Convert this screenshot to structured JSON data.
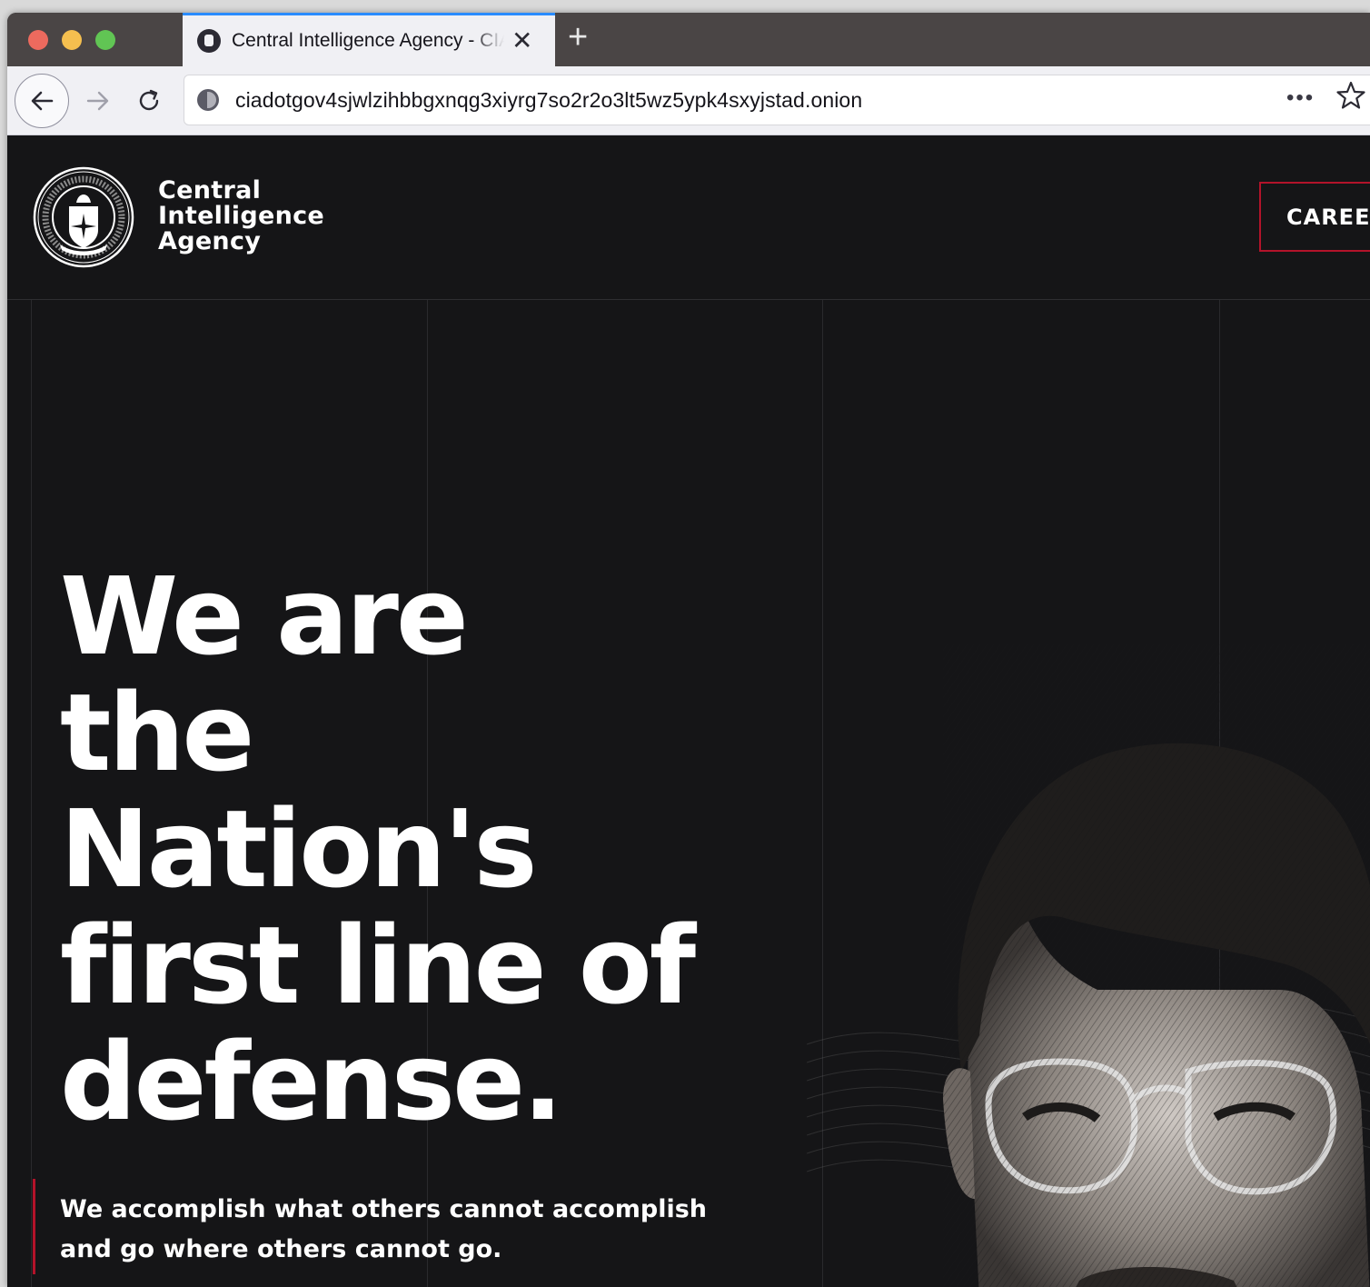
{
  "browser": {
    "tab_title": "Central Intelligence Agency - CIA",
    "new_tab_label": "+",
    "close_glyph": "✕",
    "url": "ciadotgov4sjwlzihbbgxnqg3xiyrg7so2r2o3lt5wz5ypk4sxyjstad.onion",
    "page_actions_label": "•••",
    "icons": {
      "back": "arrow-left-icon",
      "forward": "arrow-right-icon",
      "reload": "reload-icon",
      "onion": "onion-site-icon",
      "bookmark": "star-icon",
      "favicon": "cia-favicon-icon"
    },
    "traffic_light_colors": [
      "#ed6a5e",
      "#f5bf4f",
      "#61c554"
    ]
  },
  "site": {
    "brand_lines": [
      "Central",
      "Intelligence",
      "Agency"
    ],
    "careers_label": "CAREERS",
    "accent_color": "#b3132a",
    "background_color": "#151517"
  },
  "hero": {
    "headline_lines": [
      "We are",
      "the",
      "Nation's",
      "first line of",
      "defense."
    ],
    "subtext_lines": [
      "We accomplish what others cannot accomplish",
      "and go where others cannot go."
    ]
  }
}
